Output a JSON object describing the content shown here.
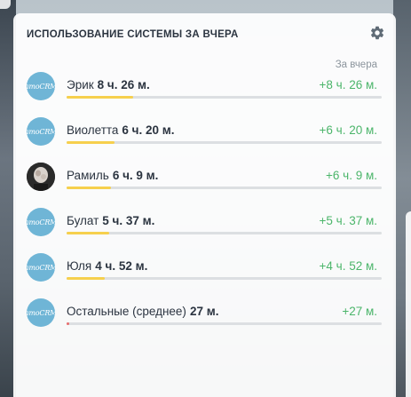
{
  "widget": {
    "title": "ИСПОЛЬЗОВАНИЕ СИСТЕМЫ ЗА ВЧЕРА",
    "period_label": "За вчера",
    "settings_icon": "gear-icon",
    "logo_text": "amoCRM"
  },
  "colors": {
    "bar_fill": "#f6d04d",
    "bar_other": "#e86f6f",
    "bar_track": "#dcdfe2",
    "delta_text": "#4bb56a",
    "avatar_bg": "#6fb5d6"
  },
  "rows": [
    {
      "name": "Эрик",
      "duration": "8 ч. 26 м.",
      "delta": "+8 ч. 26 м.",
      "fill": 0.21,
      "avatar": "logo"
    },
    {
      "name": "Виолетта",
      "duration": "6 ч. 20 м.",
      "delta": "+6 ч. 20 м.",
      "fill": 0.153,
      "avatar": "logo"
    },
    {
      "name": "Рамиль",
      "duration": "6 ч. 9 м.",
      "delta": "+6 ч. 9 м.",
      "fill": 0.141,
      "avatar": "photo"
    },
    {
      "name": "Булат",
      "duration": "5 ч. 37 м.",
      "delta": "+5 ч. 37 м.",
      "fill": 0.136,
      "avatar": "logo"
    },
    {
      "name": "Юля",
      "duration": "4 ч. 52 м.",
      "delta": "+4 ч. 52 м.",
      "fill": 0.12,
      "avatar": "logo"
    },
    {
      "name": "Остальные (среднее)",
      "duration": "27 м.",
      "delta": "+27 м.",
      "fill": 0.008,
      "avatar": "logo"
    }
  ]
}
